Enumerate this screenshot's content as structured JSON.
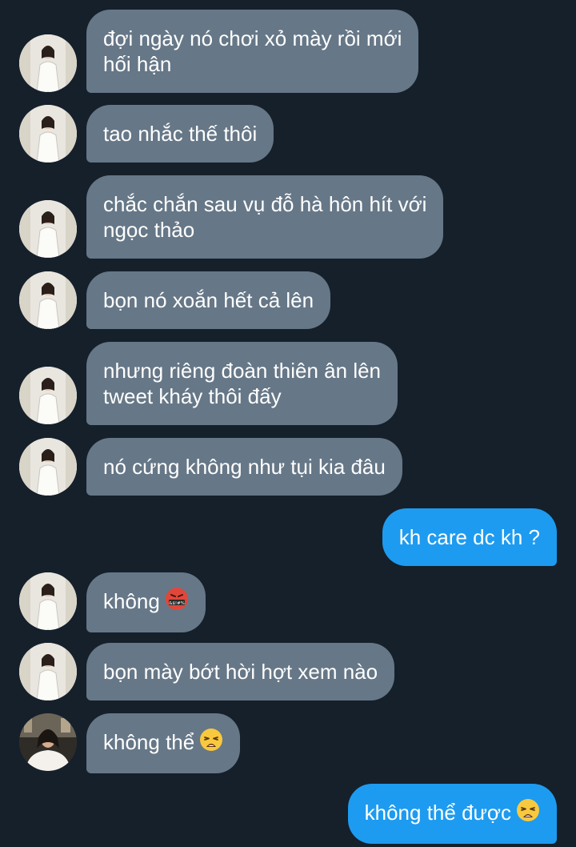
{
  "conversation": {
    "messages": [
      {
        "side": "in",
        "lines": [
          "đợi ngày nó chơi xỏ mày rồi mới",
          "hối hận"
        ]
      },
      {
        "side": "in",
        "lines": [
          "tao nhắc thế thôi"
        ]
      },
      {
        "side": "in",
        "lines": [
          "chắc chắn sau vụ đỗ hà hôn hít với",
          "ngọc thảo"
        ]
      },
      {
        "side": "in",
        "lines": [
          "bọn nó xoắn hết cả lên"
        ]
      },
      {
        "side": "in",
        "lines": [
          "nhưng riêng đoàn thiên ân lên",
          "tweet kháy thôi đấy"
        ]
      },
      {
        "side": "in",
        "lines": [
          "nó cứng không như tụi kia đâu"
        ]
      },
      {
        "side": "out",
        "lines": [
          "kh care dc kh ?"
        ]
      },
      {
        "side": "in",
        "lines": [
          "không"
        ],
        "emoji": "swearing-face-emoji"
      },
      {
        "side": "in",
        "lines": [
          "bọn mày bớt hời hợt xem nào"
        ]
      },
      {
        "side": "in",
        "lines": [
          "không thể"
        ],
        "emoji": "weary-face-emoji"
      },
      {
        "side": "out",
        "lines": [
          "không thể được"
        ],
        "emoji": "weary-face-emoji"
      }
    ]
  },
  "emoji_text": {
    "swearing": "&$!#%"
  },
  "colors": {
    "background": "#15202b",
    "incoming_bubble": "#667787",
    "outgoing_bubble": "#1d9bf0",
    "text": "#ffffff"
  }
}
